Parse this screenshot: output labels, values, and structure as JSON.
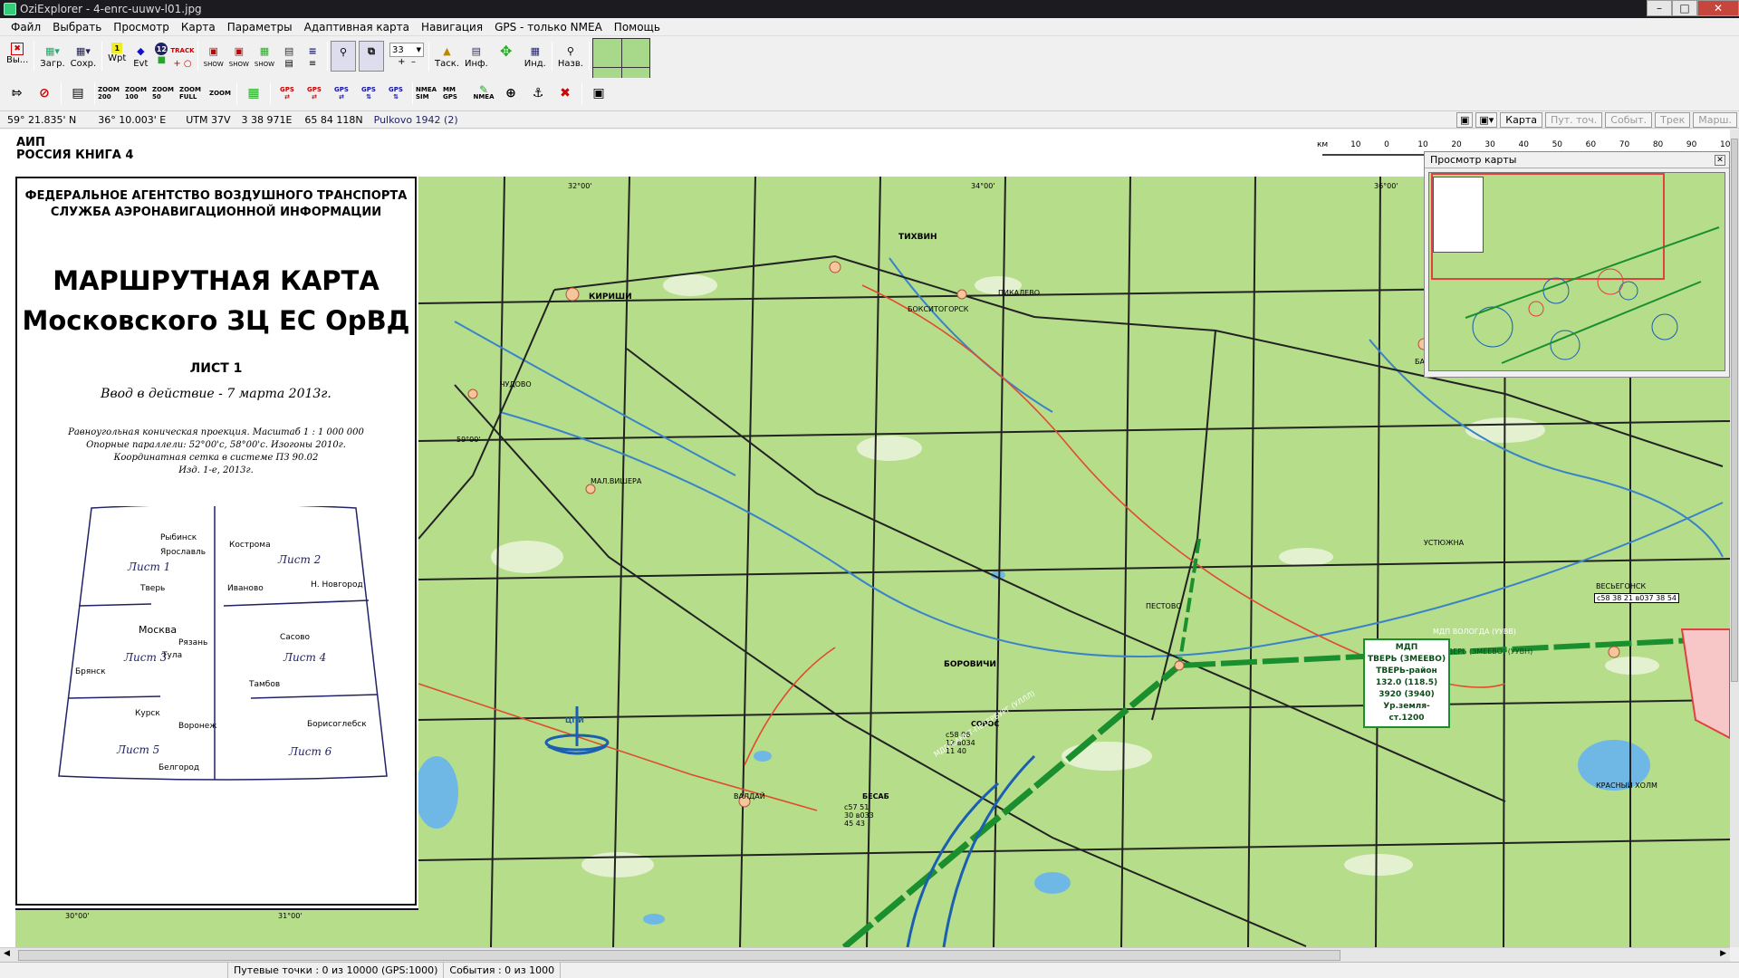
{
  "window": {
    "title": "OziExplorer - 4-enrc-uuwv-l01.jpg"
  },
  "menu": [
    "Файл",
    "Выбрать",
    "Просмотр",
    "Карта",
    "Параметры",
    "Адаптивная карта",
    "Навигация",
    "GPS - только NMEA",
    "Помощь"
  ],
  "toolbar1": {
    "exit": "Вы...",
    "load": "Загр.",
    "save": "Сохр.",
    "wpt": "Wpt",
    "evt": "Evt",
    "track": "TRACK",
    "show1": "SHOW",
    "show2": "SHOW",
    "show3": "SHOW",
    "zoom_value": "33",
    "drag": "Таск.",
    "info": "Инф.",
    "ind": "Инд.",
    "names": "Назв."
  },
  "toolbar2": {
    "zoom200": "ZOOM 200",
    "zoom100": "ZOOM 100",
    "zoom50": "ZOOM 50",
    "zoomfull": "ZOOM FULL",
    "zoom": "ZOOM",
    "gps": "GPS",
    "nmea_sim": "NMEA SIM",
    "mm_gps": "MM GPS",
    "nmea": "NMEA"
  },
  "coords": {
    "lat": "59° 21.835' N",
    "lon": "36° 10.003' E",
    "utm": "UTM  37V",
    "easting": "3 38 971E",
    "northing": "65 84 118N",
    "datum": "Pulkovo 1942 (2)"
  },
  "view_tabs": [
    "Карта",
    "Пут. точ.",
    "Событ.",
    "Трек",
    "Марш."
  ],
  "document": {
    "aip": "АИП",
    "aip_sub": "РОССИЯ   КНИГА 4",
    "agency1": "ФЕДЕРАЛЬНОЕ АГЕНТСТВО ВОЗДУШНОГО ТРАНСПОРТА",
    "agency2": "СЛУЖБА  АЭРОНАВИГАЦИОННОЙ  ИНФОРМАЦИИ",
    "title1": "МАРШРУТНАЯ КАРТА",
    "title2": "Московского ЗЦ ЕС ОрВД",
    "sheet": "ЛИСТ 1",
    "effective": "Ввод в действие - 7 марта 2013г.",
    "proj1": "Равноугольная коническая проекция. Масштаб  1 : 1 000 000",
    "proj2": "Опорные параллели: 52°00'с, 58°00'с. Изогоны 2010г.",
    "proj3": "Координатная сетка в системе ПЗ 90.02",
    "proj4": "Изд. 1-е, 2013г.",
    "index_sheets": [
      "Лист 1",
      "Лист 2",
      "Лист 3",
      "Лист 4",
      "Лист 5",
      "Лист 6"
    ],
    "index_cities": [
      "Рыбинск",
      "Ярославль",
      "Кострома",
      "Тверь",
      "Иваново",
      "Н. Новгород",
      "Москва",
      "Рязань",
      "Тула",
      "Сасово",
      "Брянск",
      "Тамбов",
      "Курск",
      "Воронеж",
      "Борисоглебск",
      "Белгород"
    ]
  },
  "map_labels": {
    "tikhvin": "ТИХВИН",
    "kirishi": "КИРИШИ",
    "pikalevo": "ПИКАЛЕВО",
    "boksitogorsk": "БОКСИТОГОРСК",
    "chudovo": "ЧУДОВО",
    "malaya_vishera": "МАЛ.ВИШЕРА",
    "babaevo": "БАБАЕВО",
    "ustyuzhna": "УСТЮЖНА",
    "vesyegonsk": "ВЕСЬЕГОНСК",
    "pestovo": "ПЕСТОВО",
    "borovichi": "БОРОВИЧИ",
    "valday": "ВАЛДАЙ",
    "krasny_kholm": "КРАСНЫЙ ХОЛМ",
    "soros": "СОРОС",
    "besab": "БЕСАБ",
    "lat_label": "59°00'",
    "lon32": "32°00'",
    "lon34": "34°00'",
    "lon36": "36°00'",
    "lon30": "30°00'",
    "lon31": "31°00'",
    "route1": "МДП ВОЛОГДА (УУВВ)",
    "route2": "МДП ТВЕРЬ (ЗМЕЕВО) (УУВН)",
    "route3": "МДП САНКТ-ПЕТЕРБУРГ (УЛЛЛ)",
    "mdp_box": [
      "МДП",
      "ТВЕРЬ (ЗМЕЕВО)",
      "ТВЕРЬ-район",
      "132.0  (118.5)",
      "3920  (3940)",
      "Ур.земля-ст.1200"
    ],
    "coord_box": "с58 38 21 в037 38 54",
    "soros_coords": "с58 06 12 в034 11 40",
    "besab_coords": "с57 51 30 в033 45 43",
    "logo": "ЦПИ"
  },
  "scale_ticks": [
    "км",
    "10",
    "0",
    "10",
    "20",
    "30",
    "40",
    "50",
    "60",
    "70",
    "80",
    "90",
    "100"
  ],
  "overview": {
    "title": "Просмотр карты"
  },
  "status": {
    "waypoints": "Путевые точки : 0 из 10000  (GPS:1000)",
    "events": "События : 0 из 1000"
  }
}
